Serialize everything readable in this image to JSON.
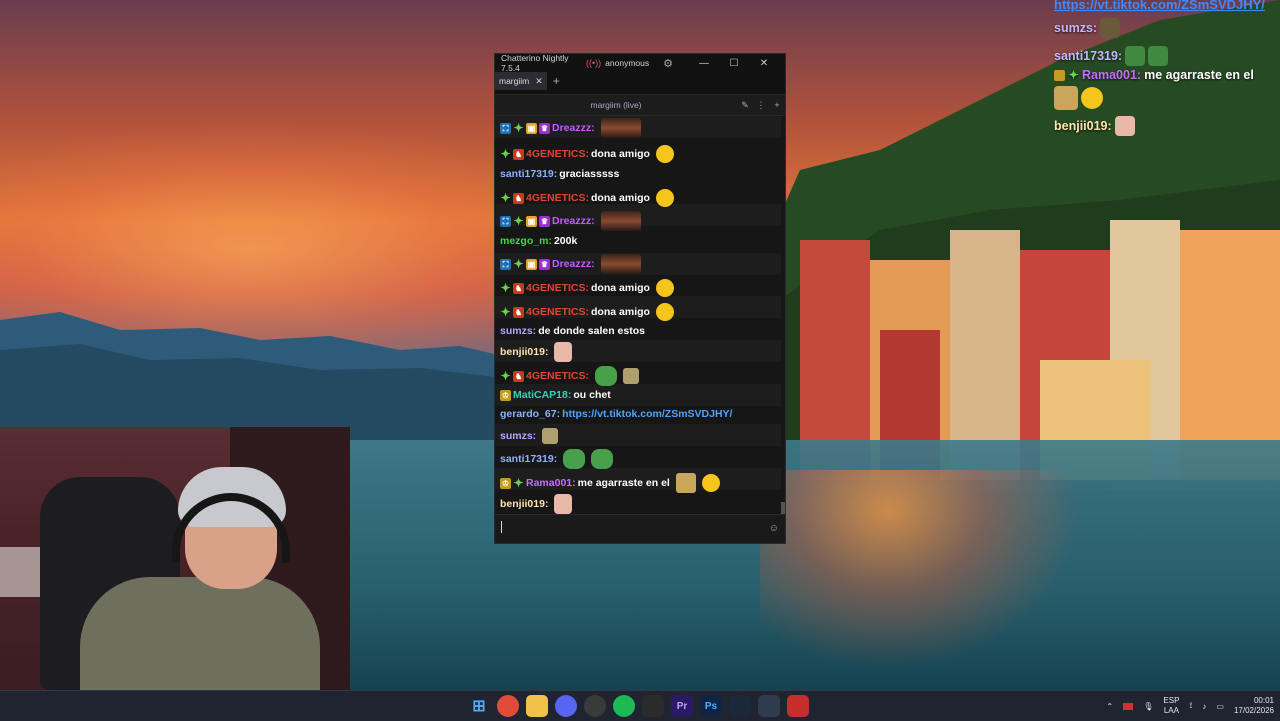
{
  "window": {
    "app_title": "Chatterino Nightly 7.5.4",
    "account": "anonymous",
    "tab_label": "margiim",
    "channel_title": "margiim (live)"
  },
  "messages": [
    {
      "user": "Dreazzz:",
      "text": "",
      "user_color": "#c45cff"
    },
    {
      "user": "4GENETICS:",
      "text": "dona amigo",
      "user_color": "#e0462e"
    },
    {
      "user": "santi17319:",
      "text": "graciasssss",
      "user_color": "#8fb0ff"
    },
    {
      "user": "4GENETICS:",
      "text": "dona amigo",
      "user_color": "#e0462e"
    },
    {
      "user": "Dreazzz:",
      "text": "",
      "user_color": "#c45cff"
    },
    {
      "user": "mezgo_m:",
      "text": "200k",
      "user_color": "#46d645"
    },
    {
      "user": "Dreazzz:",
      "text": "",
      "user_color": "#c45cff"
    },
    {
      "user": "4GENETICS:",
      "text": "dona amigo",
      "user_color": "#e0462e"
    },
    {
      "user": "4GENETICS:",
      "text": "dona amigo",
      "user_color": "#e0462e"
    },
    {
      "user": "sumzs:",
      "text": "de donde salen estos",
      "user_color": "#b4a8ff"
    },
    {
      "user": "benjii019:",
      "text": "",
      "user_color": "#ffe2b0"
    },
    {
      "user": "4GENETICS:",
      "text": "",
      "user_color": "#e0462e"
    },
    {
      "user": "MatiCAP18:",
      "text": "ou chet",
      "user_color": "#3ad0b8"
    },
    {
      "user": "gerardo_67:",
      "text": "https://vt.tiktok.com/ZSmSVDJHY/",
      "user_color": "#8fb0ff"
    },
    {
      "user": "sumzs:",
      "text": "",
      "user_color": "#b4a8ff"
    },
    {
      "user": "santi17319:",
      "text": "",
      "user_color": "#8fb0ff"
    },
    {
      "user": "Rama001:",
      "text": "me agarraste en el",
      "user_color": "#c76cff"
    },
    {
      "user": "benjii019:",
      "text": "",
      "user_color": "#ffe2b0"
    }
  ],
  "overlay": {
    "url": "https://vt.tiktok.com/ZSmSVDJHY/",
    "lines": [
      {
        "user": "sumzs:",
        "text": ""
      },
      {
        "user": "santi17319:",
        "text": ""
      },
      {
        "user": "Rama001:",
        "text": "me agarraste en el"
      },
      {
        "user": "benjii019:",
        "text": ""
      }
    ]
  },
  "taskbar": {
    "icons": [
      "windows-start",
      "chrome",
      "file-explorer",
      "discord",
      "obs",
      "spotify",
      "epic-games",
      "premiere-pro",
      "photoshop",
      "steam",
      "chatterino",
      "streamer-app"
    ],
    "tray": {
      "lang_top": "ESP",
      "lang_bottom": "LAA",
      "time": "00:01",
      "date": "17/02/2026"
    }
  },
  "colors": {
    "chat_bg": "#161616",
    "link": "#4fa3ff",
    "taskbar": "#1f2430"
  }
}
